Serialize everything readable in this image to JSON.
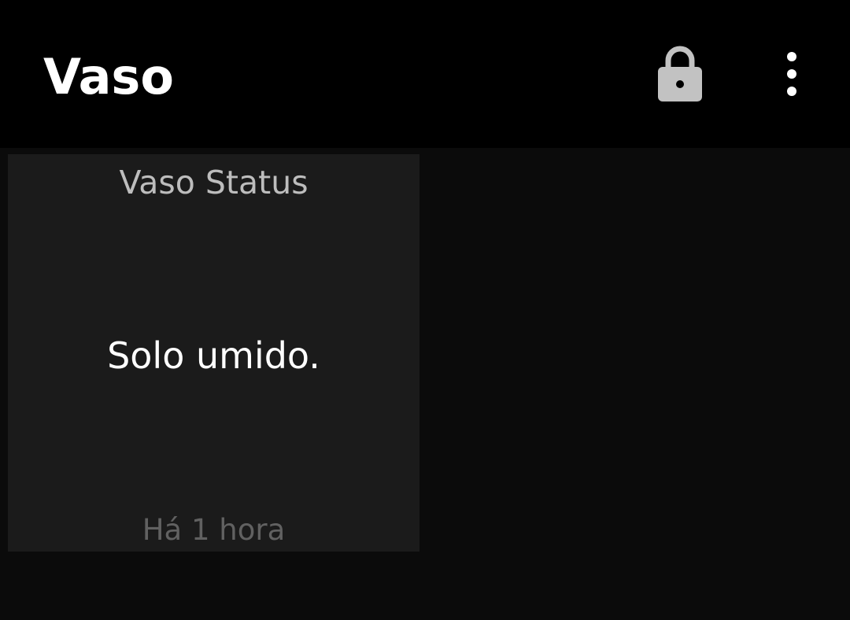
{
  "app_bar": {
    "title": "Vaso",
    "icons": {
      "lock": "lock-icon",
      "more": "more-vert-icon"
    },
    "icon_color": "#c2c2c2"
  },
  "tile": {
    "title": "Vaso Status",
    "value": "Solo umido.",
    "timestamp": "Há 1 hora"
  },
  "colors": {
    "app_bar_bg": "#000000",
    "content_bg": "#0b0b0b",
    "tile_bg": "#1b1b1b"
  }
}
